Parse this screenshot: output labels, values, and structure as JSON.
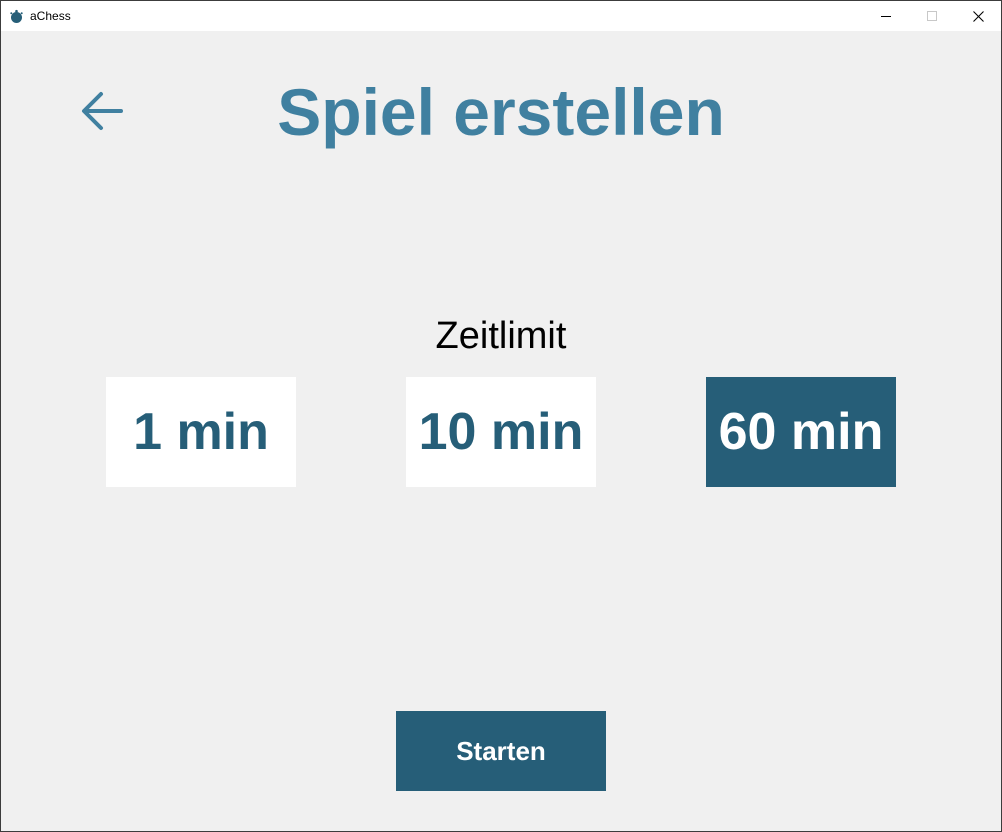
{
  "window": {
    "title": "aChess",
    "icon": "chess-app-icon",
    "controls": [
      "minimize-icon",
      "maximize-icon",
      "close-icon"
    ]
  },
  "header": {
    "back_icon": "arrow-left-icon",
    "title": "Spiel erstellen"
  },
  "time_limit": {
    "label": "Zeitlimit",
    "options": [
      {
        "label": "1 min",
        "selected": false
      },
      {
        "label": "10 min",
        "selected": false
      },
      {
        "label": "60 min",
        "selected": true
      }
    ]
  },
  "actions": {
    "start_label": "Starten"
  },
  "colors": {
    "accent": "#265e78",
    "title": "#4080a0",
    "background": "#f0f0f0"
  }
}
